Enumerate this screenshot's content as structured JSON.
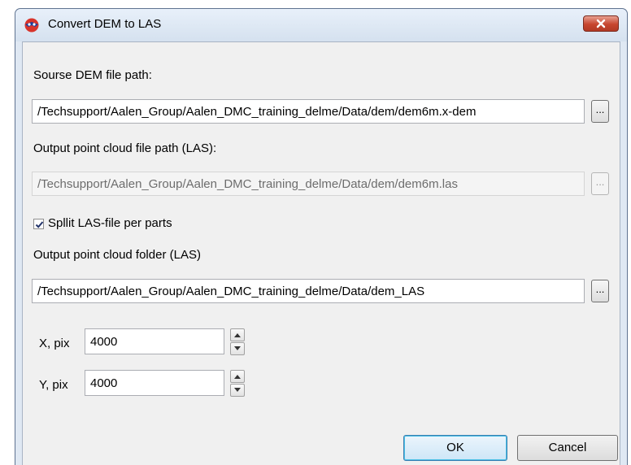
{
  "window": {
    "title": "Convert DEM to LAS",
    "close_icon": "close-icon"
  },
  "source_dem": {
    "label": "Sourse DEM file path:",
    "value": "/Techsupport/Aalen_Group/Aalen_DMC_training_delme/Data/dem/dem6m.x-dem",
    "browse_label": "..."
  },
  "output_las": {
    "label": "Output point cloud file path (LAS):",
    "value": "/Techsupport/Aalen_Group/Aalen_DMC_training_delme/Data/dem/dem6m.las",
    "browse_label": "...",
    "disabled": true
  },
  "split": {
    "label": "Spllit LAS-file per parts",
    "checked": true
  },
  "output_folder": {
    "label": "Output point cloud folder (LAS)",
    "value": "/Techsupport/Aalen_Group/Aalen_DMC_training_delme/Data/dem_LAS",
    "browse_label": "..."
  },
  "x_pix": {
    "label": "X, pix",
    "value": "4000"
  },
  "y_pix": {
    "label": "Y, pix",
    "value": "4000"
  },
  "buttons": {
    "ok": "OK",
    "cancel": "Cancel"
  }
}
